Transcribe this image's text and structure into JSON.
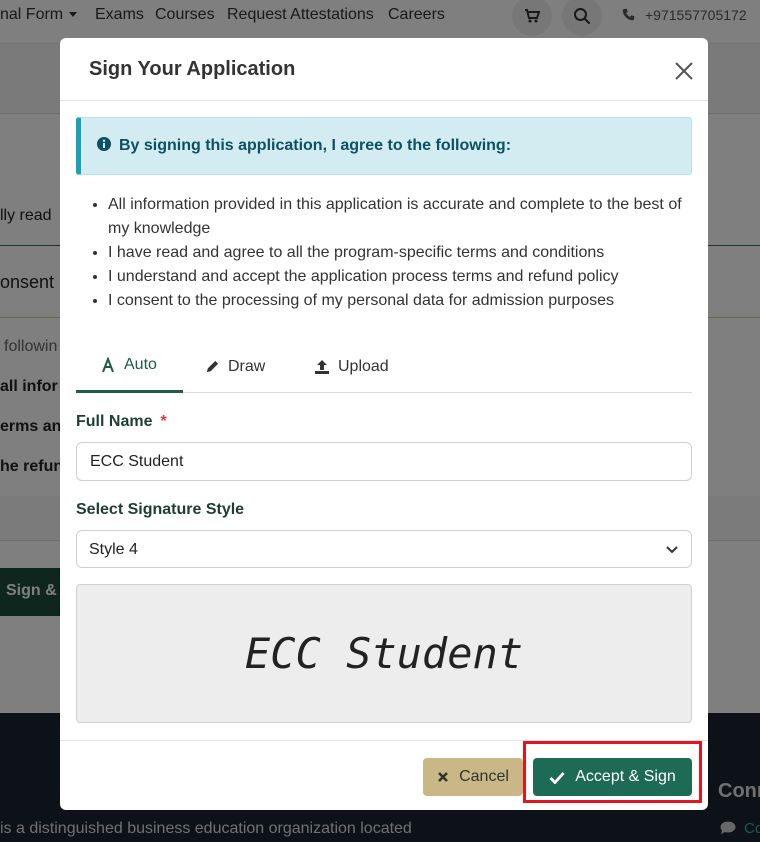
{
  "navbar": {
    "items": [
      "nal Form",
      "Exams",
      "Courses",
      "Request Attestations",
      "Careers"
    ],
    "phone": "+971557705172",
    "cart_icon": "cart-icon",
    "search_icon": "search-icon",
    "phone_icon": "phone-icon"
  },
  "background": {
    "line1": "lly read",
    "line2": "onsent",
    "line3": "followin",
    "line4": "all infor",
    "line5": "erms an",
    "line6": "he refun",
    "sign_button": "Sign &",
    "footer_text": "is a distinguished business education organization located",
    "footer_heading": "Conn",
    "footer_link": "Co"
  },
  "modal": {
    "title": "Sign Your Application",
    "alert": "By signing this application, I agree to the following:",
    "terms": [
      "All information provided in this application is accurate and complete to the best of my knowledge",
      "I have read and agree to all the program-specific terms and conditions",
      "I understand and accept the application process terms and refund policy",
      "I consent to the processing of my personal data for admission purposes"
    ],
    "tabs": [
      {
        "label": "Auto",
        "icon": "font-icon",
        "active": true
      },
      {
        "label": "Draw",
        "icon": "pencil-icon",
        "active": false
      },
      {
        "label": "Upload",
        "icon": "upload-icon",
        "active": false
      }
    ],
    "full_name_label": "Full Name",
    "required_mark": "*",
    "full_name_value": "ECC Student",
    "style_label": "Select Signature Style",
    "style_value": "Style 4",
    "preview_text": "ECC Student",
    "cancel_label": "Cancel",
    "accept_label": "Accept & Sign"
  },
  "colors": {
    "accent": "#1e6b55",
    "cancel": "#c9b886",
    "alert_bg": "#d3ecf2",
    "highlight": "#e0161e"
  }
}
